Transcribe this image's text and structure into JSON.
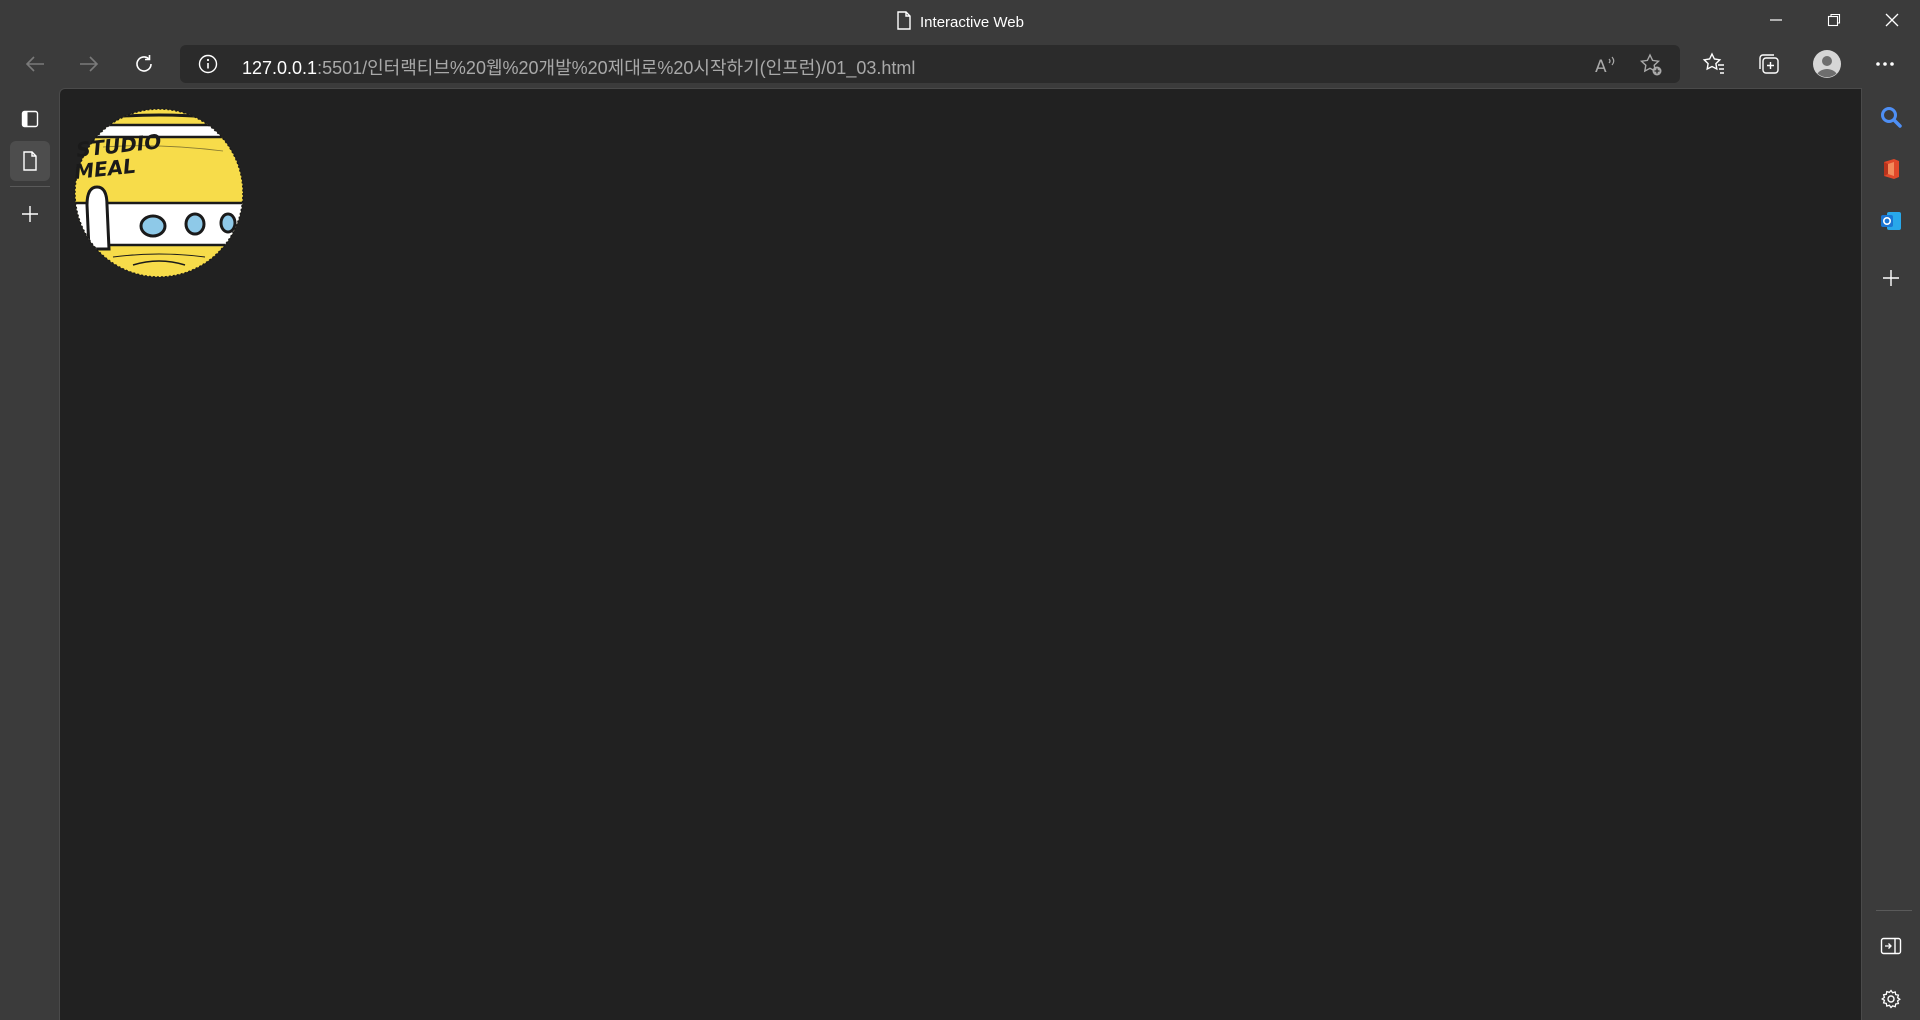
{
  "window": {
    "title": "Interactive Web"
  },
  "toolbar": {
    "url_host": "127.0.0.1",
    "url_rest": ":5501/인터랙티브%20웹%20개발%20제대로%20시작하기(인프런)/01_03.html"
  },
  "logo": {
    "line1": "STUDIO",
    "line2": "MEAL",
    "colors": {
      "yellow": "#f7dc4a",
      "window": "#8ec9e8",
      "outline": "#1a1a1a"
    }
  },
  "colors": {
    "chrome": "#3b3b3b",
    "page_bg": "#212121",
    "address_bg": "#2b2b2b",
    "search_accent": "#4e8ff5",
    "office_accent": "#e0482a",
    "outlook_accent": "#1a75d2"
  },
  "icons": {
    "left_sidebar": [
      "tab-actions-icon",
      "page-icon",
      "plus-icon"
    ],
    "right_sidebar": [
      "search-icon",
      "office-icon",
      "outlook-icon",
      "plus-icon",
      "hide-sidebar-icon",
      "settings-icon"
    ]
  }
}
